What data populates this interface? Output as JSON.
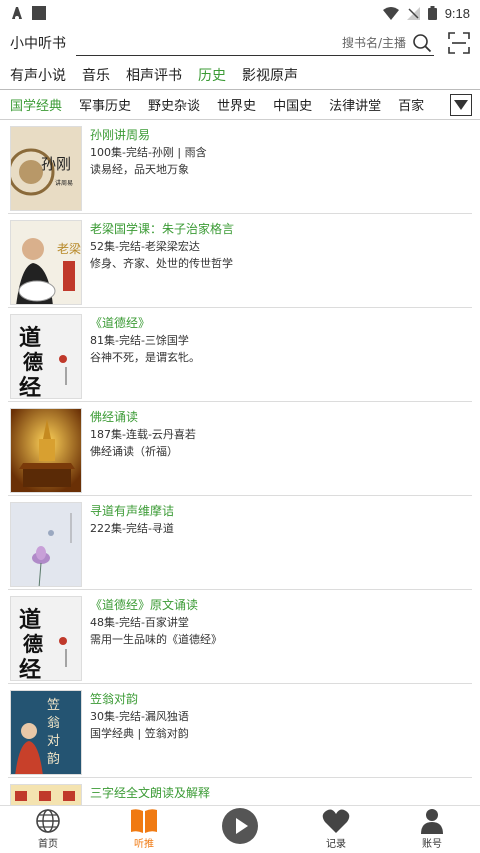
{
  "statusbar": {
    "time": "9:18"
  },
  "header": {
    "app_title": "小中听书",
    "search_placeholder": "搜书名/主播"
  },
  "categories": [
    "有声小说",
    "音乐",
    "相声评书",
    "历史",
    "影视原声"
  ],
  "active_category": "历史",
  "subtabs": [
    "国学经典",
    "军事历史",
    "野史杂谈",
    "世界史",
    "中国史",
    "法律讲堂",
    "百家"
  ],
  "active_subtab": "国学经典",
  "books": [
    {
      "title": "孙刚讲周易",
      "info": "100集-完结-孙刚 | 雨含",
      "desc": "读易经，品天地万象"
    },
    {
      "title": "老梁国学课：朱子治家格言",
      "info": "52集-完结-老梁梁宏达",
      "desc": "修身、齐家、处世的传世哲学"
    },
    {
      "title": "《道德经》",
      "info": "81集-完结-三馀国学",
      "desc": "谷神不死，是谓玄牝。"
    },
    {
      "title": "佛经诵读",
      "info": "187集-连载-云丹喜若",
      "desc": "佛经诵读（祈福）"
    },
    {
      "title": "寻道有声维摩诘",
      "info": "222集-完结-寻道",
      "desc": ""
    },
    {
      "title": "《道德经》原文诵读",
      "info": "48集-完结-百家讲堂",
      "desc": "需用一生品味的《道德经》"
    },
    {
      "title": "笠翁对韵",
      "info": "30集-完结-漏风独语",
      "desc": "国学经典 | 笠翁对韵"
    },
    {
      "title": "三字经全文朗读及解释",
      "info": "",
      "desc": ""
    }
  ],
  "cover_text": {
    "c1": "孙刚",
    "c1b": "讲周易",
    "c2": "老梁",
    "c3": "道德经",
    "c6": "道德经",
    "c7": "笠翁对韵"
  },
  "bottomnav": [
    "首页",
    "听推",
    "",
    "记录",
    "账号"
  ],
  "colors": {
    "accent_green": "#3b9b35",
    "accent_orange": "#f07a12"
  }
}
